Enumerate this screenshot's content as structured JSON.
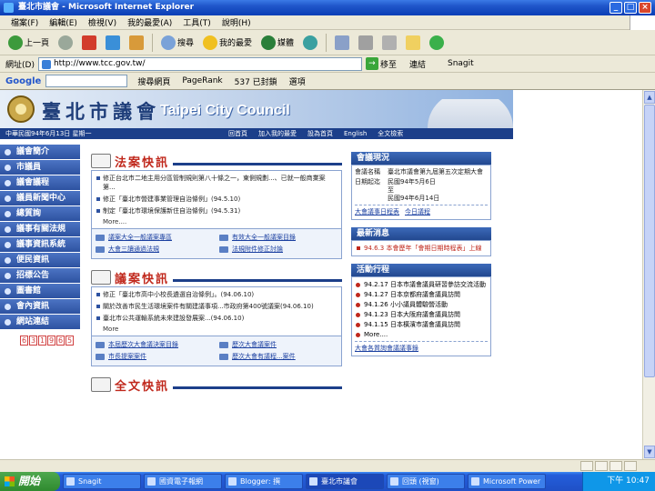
{
  "window": {
    "title": "臺北市議會 - Microsoft Internet Explorer",
    "minimize": "_",
    "maximize": "□",
    "close": "×"
  },
  "menu": [
    "檔案(F)",
    "編輯(E)",
    "檢視(V)",
    "我的最愛(A)",
    "工具(T)",
    "說明(H)"
  ],
  "toolbar": {
    "back": "上一頁",
    "search": "搜尋",
    "favorites": "我的最愛",
    "media": "媒體"
  },
  "address": {
    "label": "網址(D)",
    "url": "http://www.tcc.gov.tw/",
    "go": "移至",
    "links": "連結",
    "snagit": "Snagit"
  },
  "google": {
    "logo": "Google",
    "search_web": "搜尋網頁",
    "pagerank": "PageRank",
    "blocked": "537 已封鎖",
    "options": "選項"
  },
  "banner": {
    "name_cn": "臺北市議會",
    "name_en": "Taipei City Council"
  },
  "navstrip": {
    "date": "中華民國94年6月13日 星期一",
    "links": [
      "回首頁",
      "加入我的最愛",
      "設為首頁",
      "English",
      "全文檢索"
    ]
  },
  "sidebar": [
    "議會簡介",
    "市議員",
    "議會議程",
    "議員新聞中心",
    "總質詢",
    "議事有關法規",
    "議事資訊系統",
    "便民資訊",
    "招標公告",
    "圖書館",
    "會內資訊",
    "網站連結"
  ],
  "counter": [
    "6",
    "3",
    "1",
    "9",
    "6",
    "5"
  ],
  "laws": {
    "heading": "法案快訊",
    "items": [
      "修正台北市二地主用分區管制規則第八十條之一，東側規劃...、已就一般商業案第...",
      "修正「臺北市營建事業管理自治條例」(94.5.10)",
      "制定「臺北市環境保護新住自治條例」(94.5.31)"
    ],
    "more": "More....",
    "links": [
      "議案大全一般議案專區",
      "有效大全一般議案目錄",
      "大會三讀通過法規",
      "法規附件修正討論"
    ]
  },
  "proposals": {
    "heading": "議案快訊",
    "items": [
      "修正「臺北市高中小校長遴選自治條例」。(94.06.10)",
      "關於改善市民生活環境案件有關建議事項...市政府第400號議案(94.06.10)",
      "臺北市公共運輸系統未來建設發展案...(94.06.10)"
    ],
    "more": "More",
    "links": [
      "本屆歷次大會議決案目錄",
      "歷次大會議案件",
      "市長提案案件",
      "歷次大會有議程...案件"
    ]
  },
  "fulltext": {
    "heading": "全文快訊"
  },
  "meeting": {
    "title": "會議現況",
    "name_label": "會議名稱",
    "name_value": "臺北市議會第九屆第五次定期大會",
    "date_label": "日期起迄",
    "date_from": "民國94年5月6日",
    "date_to_prefix": "至",
    "date_to": "民國94年6月14日",
    "links": [
      "大會議事日程表",
      "今日議程"
    ]
  },
  "latest": {
    "title": "最新消息",
    "item": "94.6.3 本會歷年「會期日期時程表」上線"
  },
  "events": {
    "title": "活動行程",
    "items": [
      "94.2.17 日本市議會議員研習參訪交流活動",
      "94.1.27 日本京都府議會議員訪問",
      "94.1.26 小小議員體驗營活動",
      "94.1.23 日本大阪府議會議員訪問",
      "94.1.15 日本橫濱市議會議員訪問"
    ],
    "more": "More....",
    "footer": "大會各質詢會議議事錄"
  },
  "taskbar": {
    "start": "開始",
    "tasks": [
      "Snagit",
      "國資電子報網",
      "Blogger: 撰",
      "臺北市議會",
      "回頭 (視窗)",
      "Microsoft Power"
    ],
    "clock": "下午 10:47"
  }
}
